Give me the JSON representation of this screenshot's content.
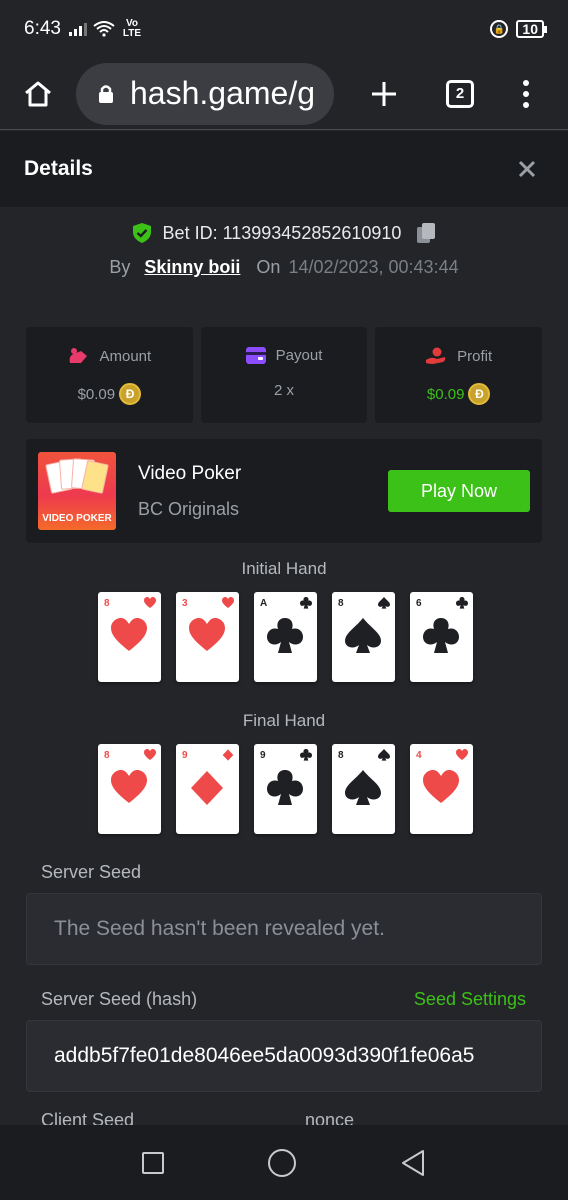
{
  "status_bar": {
    "time": "6:43",
    "network": "Vo LTE",
    "battery": "10"
  },
  "browser": {
    "url": "hash.game/g",
    "tab_count": "2"
  },
  "header": {
    "title": "Details",
    "close": "✕"
  },
  "bet": {
    "id_label": "Bet ID: 113993452852610910",
    "by_label": "By",
    "username": "Skinny boii",
    "on_label": "On",
    "date": "14/02/2023, 00:43:44"
  },
  "stats": [
    {
      "label": "Amount",
      "value": "$0.09",
      "icon": "money-bag-icon",
      "color": "#e83a6b"
    },
    {
      "label": "Payout",
      "value": "2 x",
      "icon": "wallet-icon",
      "color": "#8b4dff"
    },
    {
      "label": "Profit",
      "value": "$0.09",
      "icon": "profit-hand-icon",
      "color": "#e23b3b"
    }
  ],
  "coin_symbol": "Đ",
  "game": {
    "name": "Video Poker",
    "provider": "BC Originals",
    "play_label": "Play Now",
    "thumb_label": "VIDEO POKER"
  },
  "initial_hand": {
    "title": "Initial Hand",
    "cards": [
      {
        "rank": "8",
        "suit": "heart"
      },
      {
        "rank": "3",
        "suit": "heart"
      },
      {
        "rank": "A",
        "suit": "club"
      },
      {
        "rank": "8",
        "suit": "spade"
      },
      {
        "rank": "6",
        "suit": "club"
      }
    ]
  },
  "final_hand": {
    "title": "Final Hand",
    "cards": [
      {
        "rank": "8",
        "suit": "heart"
      },
      {
        "rank": "9",
        "suit": "diamond"
      },
      {
        "rank": "9",
        "suit": "club"
      },
      {
        "rank": "8",
        "suit": "spade"
      },
      {
        "rank": "4",
        "suit": "heart"
      }
    ]
  },
  "server_seed": {
    "label": "Server Seed",
    "placeholder": "The Seed hasn't been revealed yet."
  },
  "server_seed_hash": {
    "label": "Server Seed (hash)",
    "settings_label": "Seed Settings",
    "value": "addb5f7fe01de8046ee5da0093d390f1fe06a5"
  },
  "client_seed": {
    "label": "Client Seed",
    "nonce_label": "nonce"
  },
  "colors": {
    "accent_green": "#3bc117",
    "panel": "#1a1c20",
    "background": "#232529"
  }
}
